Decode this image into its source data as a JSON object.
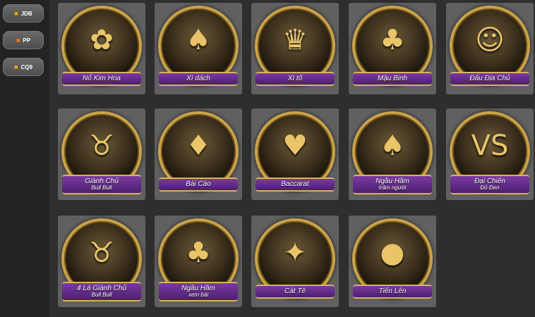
{
  "providers": [
    {
      "logo": "JDB",
      "label": "JDB",
      "logo_color": "#f2a800"
    },
    {
      "logo": "PP",
      "label": "PP",
      "logo_color": "#ff7a1a"
    },
    {
      "logo": "CQ9",
      "label": "CQ9",
      "logo_color": "#f2a800"
    }
  ],
  "games": [
    {
      "name": "Nổ Kim Hoa",
      "sub": "",
      "icon": "rose-coin-icon",
      "glyph": "✿"
    },
    {
      "name": "Xì dách",
      "sub": "",
      "icon": "top-hat-cards-icon",
      "glyph": "♠"
    },
    {
      "name": "Xì tố",
      "sub": "",
      "icon": "crown-icon",
      "glyph": "♛"
    },
    {
      "name": "Mậu Binh",
      "sub": "",
      "icon": "revolver-cards-icon",
      "glyph": "♣"
    },
    {
      "name": "Đấu Địa Chủ",
      "sub": "",
      "icon": "landlord-character-icon",
      "glyph": "☺"
    },
    {
      "name": "Giành Chủ",
      "sub": "Bull Bull",
      "icon": "golden-bull-icon",
      "glyph": "♉"
    },
    {
      "name": "Bài Cào",
      "sub": "",
      "icon": "golden-toad-icon",
      "glyph": "♦"
    },
    {
      "name": "Baccarat",
      "sub": "",
      "icon": "playing-cards-icon",
      "glyph": "♥"
    },
    {
      "name": "Ngầu Hầm",
      "sub": "trăm người",
      "icon": "gold-ingot-icon",
      "glyph": "♠"
    },
    {
      "name": "Đại Chiến",
      "sub": "Đỏ Đen",
      "icon": "versus-cards-icon",
      "glyph": "VS"
    },
    {
      "name": "4 Lá Giành Chủ",
      "sub": "Bull Bull",
      "icon": "golden-bull-cards-icon",
      "glyph": "♉"
    },
    {
      "name": "Ngầu Hầm",
      "sub": "xem bài",
      "icon": "cartoon-bull-icon",
      "glyph": "♣"
    },
    {
      "name": "Cát Tê",
      "sub": "",
      "icon": "white-cat-icon",
      "glyph": "✦"
    },
    {
      "name": "Tiến Lên",
      "sub": "",
      "icon": "bomb-icon",
      "glyph": "●"
    }
  ]
}
